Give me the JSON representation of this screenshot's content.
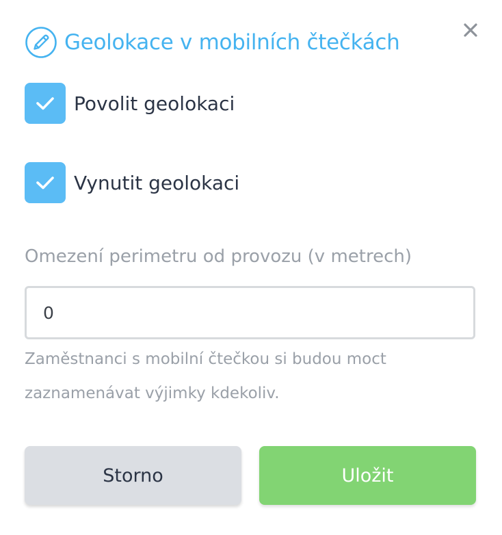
{
  "dialog": {
    "title": "Geolokace v mobilních čtečkách",
    "title_icon": "pencil-circle-icon",
    "close_icon": "close-icon"
  },
  "options": [
    {
      "label": "Povolit geolokaci",
      "checked": true
    },
    {
      "label": "Vynutit geolokaci",
      "checked": true
    }
  ],
  "perimeter": {
    "label": "Omezení perimetru od provozu (v metrech)",
    "value": "0",
    "helper": "Zaměstnanci s mobilní čtečkou si budou moct zaznamenávat výjimky kdekoliv."
  },
  "buttons": {
    "cancel_label": "Storno",
    "save_label": "Uložit"
  },
  "colors": {
    "accent": "#45b3f0",
    "checkbox": "#5bbcf5",
    "save": "#82d473",
    "cancel": "#dbdee3"
  }
}
